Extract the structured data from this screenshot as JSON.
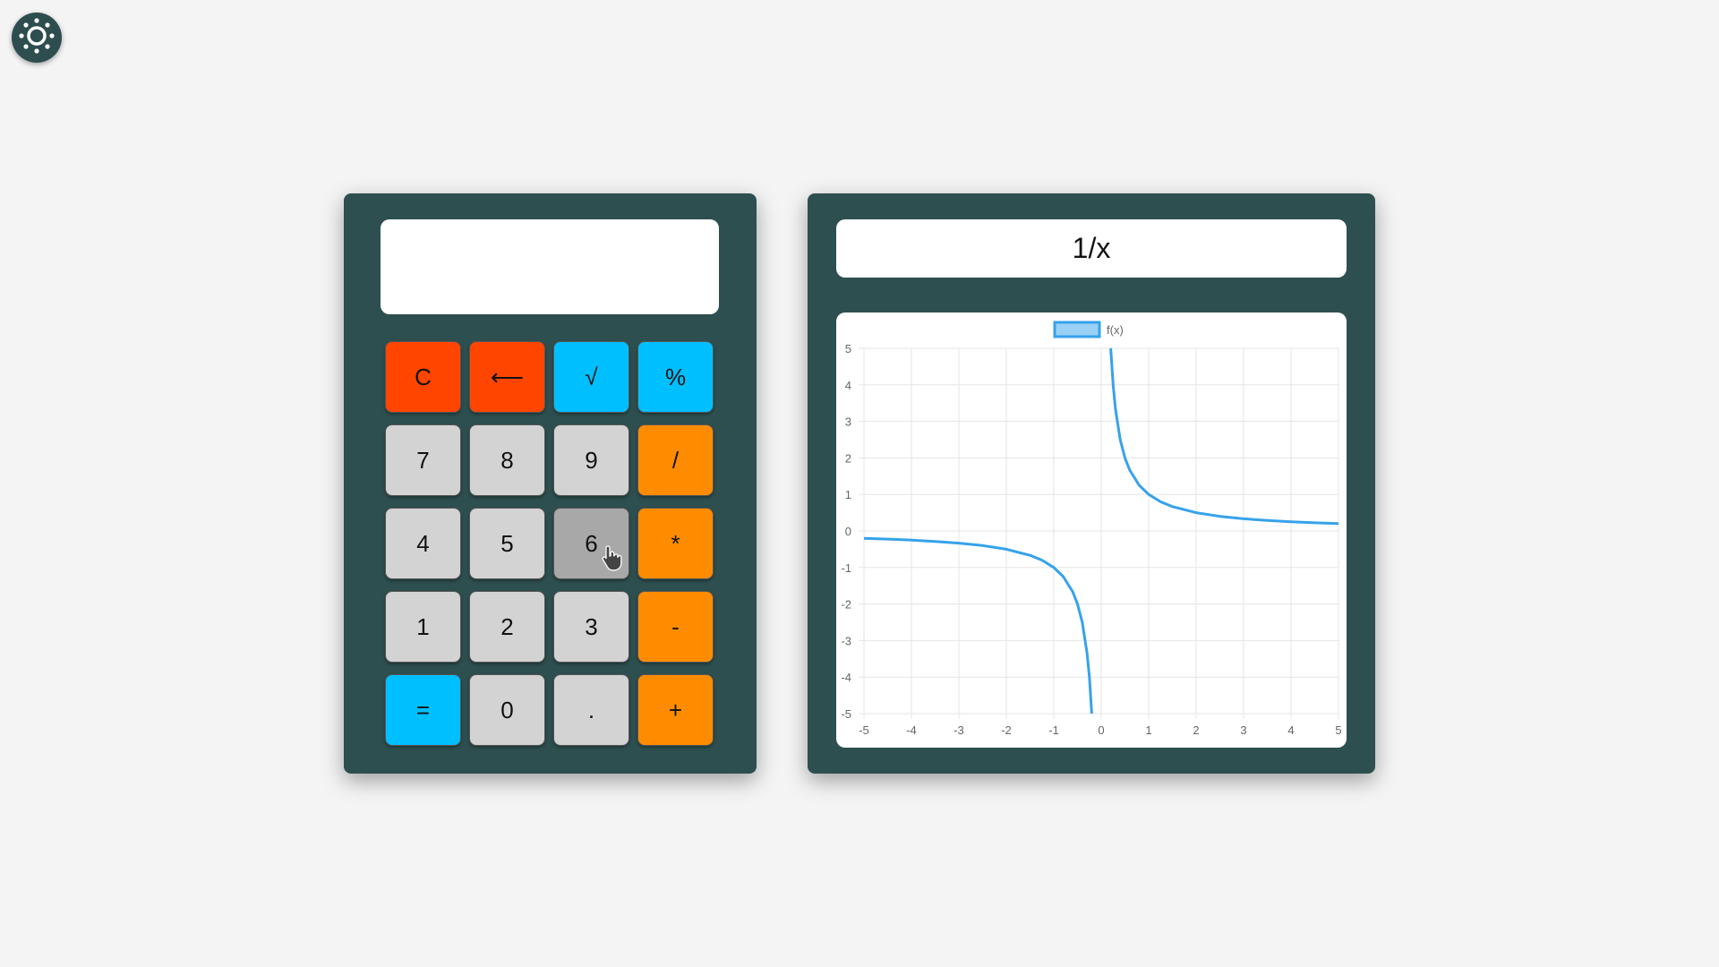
{
  "theme_toggle": {
    "icon": "sun-icon"
  },
  "calculator": {
    "display_value": "",
    "keys": [
      {
        "label": "C",
        "name": "clear-button",
        "variant": "red"
      },
      {
        "label": "⟵",
        "name": "backspace-button",
        "variant": "red"
      },
      {
        "label": "√",
        "name": "sqrt-button",
        "variant": "blue"
      },
      {
        "label": "%",
        "name": "percent-button",
        "variant": "blue"
      },
      {
        "label": "7",
        "name": "digit-7-button",
        "variant": "gray"
      },
      {
        "label": "8",
        "name": "digit-8-button",
        "variant": "gray"
      },
      {
        "label": "9",
        "name": "digit-9-button",
        "variant": "gray"
      },
      {
        "label": "/",
        "name": "divide-button",
        "variant": "orange"
      },
      {
        "label": "4",
        "name": "digit-4-button",
        "variant": "gray"
      },
      {
        "label": "5",
        "name": "digit-5-button",
        "variant": "gray"
      },
      {
        "label": "6",
        "name": "digit-6-button",
        "variant": "gray",
        "hover": true
      },
      {
        "label": "*",
        "name": "multiply-button",
        "variant": "orange"
      },
      {
        "label": "1",
        "name": "digit-1-button",
        "variant": "gray"
      },
      {
        "label": "2",
        "name": "digit-2-button",
        "variant": "gray"
      },
      {
        "label": "3",
        "name": "digit-3-button",
        "variant": "gray"
      },
      {
        "label": "-",
        "name": "subtract-button",
        "variant": "orange"
      },
      {
        "label": "=",
        "name": "equals-button",
        "variant": "blue"
      },
      {
        "label": "0",
        "name": "digit-0-button",
        "variant": "gray"
      },
      {
        "label": ".",
        "name": "decimal-button",
        "variant": "gray"
      },
      {
        "label": "+",
        "name": "add-button",
        "variant": "orange"
      }
    ]
  },
  "grapher": {
    "function_value": "1/x"
  },
  "chart_data": {
    "type": "line",
    "title": "",
    "xlabel": "",
    "ylabel": "",
    "xlim": [
      -5,
      5
    ],
    "ylim": [
      -5,
      5
    ],
    "x_ticks": [
      "-5",
      "-4",
      "-3",
      "-2",
      "-1",
      "0",
      "1",
      "2",
      "3",
      "4",
      "5"
    ],
    "y_ticks": [
      "5",
      "4",
      "3",
      "2",
      "1",
      "0",
      "-1",
      "-2",
      "-3",
      "-4",
      "-5"
    ],
    "grid": true,
    "legend": "top-center",
    "series": [
      {
        "name": "f(x)",
        "color": "#36a2eb",
        "fill": "#9ad0f5",
        "x": [
          -5,
          -4.5,
          -4,
          -3.5,
          -3,
          -2.5,
          -2,
          -1.5,
          -1.25,
          -1,
          -0.8,
          -0.6,
          -0.5,
          -0.4,
          -0.3,
          -0.25,
          -0.2,
          0.2,
          0.25,
          0.3,
          0.4,
          0.5,
          0.6,
          0.8,
          1,
          1.25,
          1.5,
          2,
          2.5,
          3,
          3.5,
          4,
          4.5,
          5
        ],
        "y": [
          -0.2,
          -0.222,
          -0.25,
          -0.286,
          -0.333,
          -0.4,
          -0.5,
          -0.667,
          -0.8,
          -1,
          -1.25,
          -1.667,
          -2,
          -2.5,
          -3.333,
          -4,
          -5,
          5,
          4,
          3.333,
          2.5,
          2,
          1.667,
          1.25,
          1,
          0.8,
          0.667,
          0.5,
          0.4,
          0.333,
          0.286,
          0.25,
          0.222,
          0.2
        ]
      }
    ],
    "colors": {
      "grid": "#e5e5e5",
      "tick_text": "#666666"
    }
  }
}
